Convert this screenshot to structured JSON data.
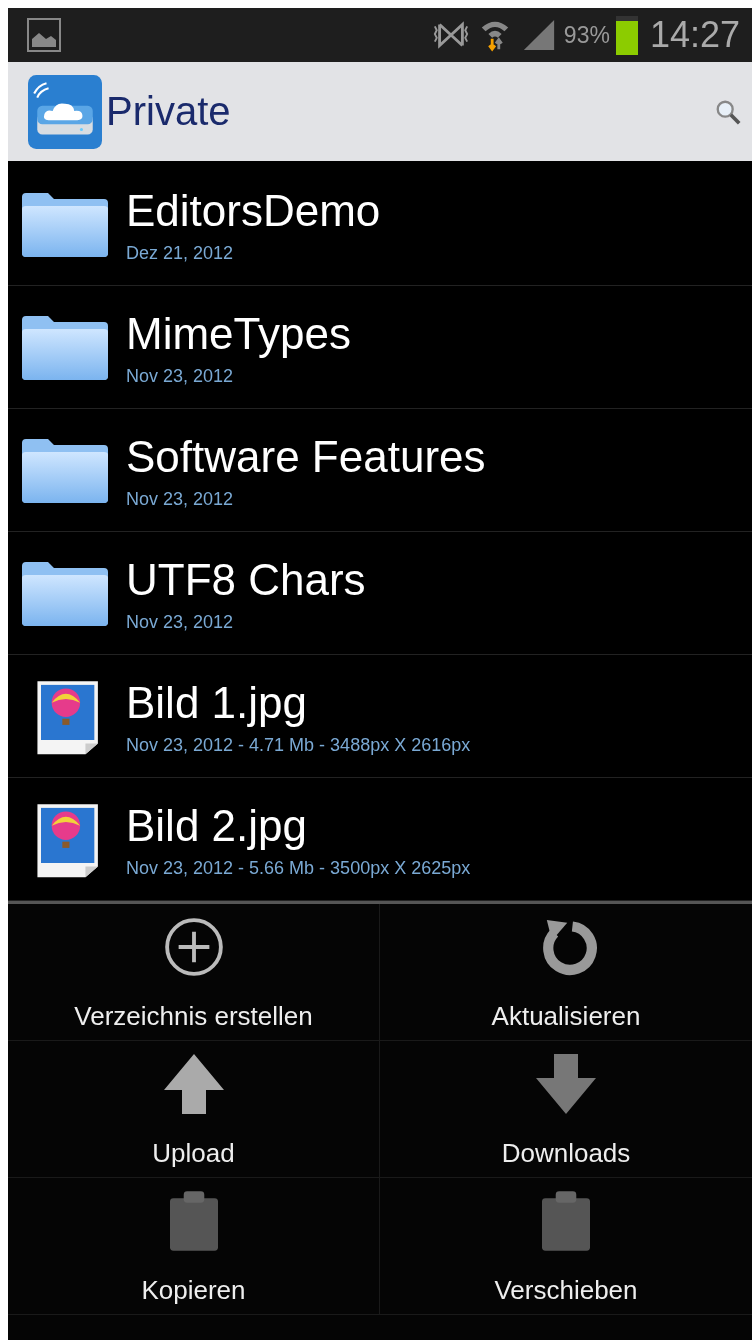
{
  "status_bar": {
    "battery": "93%",
    "time": "14:27"
  },
  "action_bar": {
    "title": "Private"
  },
  "files": [
    {
      "kind": "folder",
      "name": "EditorsDemo",
      "details": "Dez 21, 2012"
    },
    {
      "kind": "folder",
      "name": "MimeTypes",
      "details": "Nov 23, 2012"
    },
    {
      "kind": "folder",
      "name": "Software Features",
      "details": "Nov 23, 2012"
    },
    {
      "kind": "folder",
      "name": "UTF8 Chars",
      "details": "Nov 23, 2012"
    },
    {
      "kind": "image",
      "name": "Bild 1.jpg",
      "details": "Nov 23, 2012 - 4.71 Mb - 3488px X 2616px"
    },
    {
      "kind": "image",
      "name": "Bild 2.jpg",
      "details": "Nov 23, 2012 - 5.66 Mb - 3500px X 2625px"
    }
  ],
  "menu": [
    {
      "kind": "create",
      "label": "Verzeichnis erstellen"
    },
    {
      "kind": "refresh",
      "label": "Aktualisieren"
    },
    {
      "kind": "upload",
      "label": "Upload"
    },
    {
      "kind": "download",
      "label": "Downloads"
    },
    {
      "kind": "copy",
      "label": "Kopieren"
    },
    {
      "kind": "move",
      "label": "Verschieben"
    }
  ]
}
